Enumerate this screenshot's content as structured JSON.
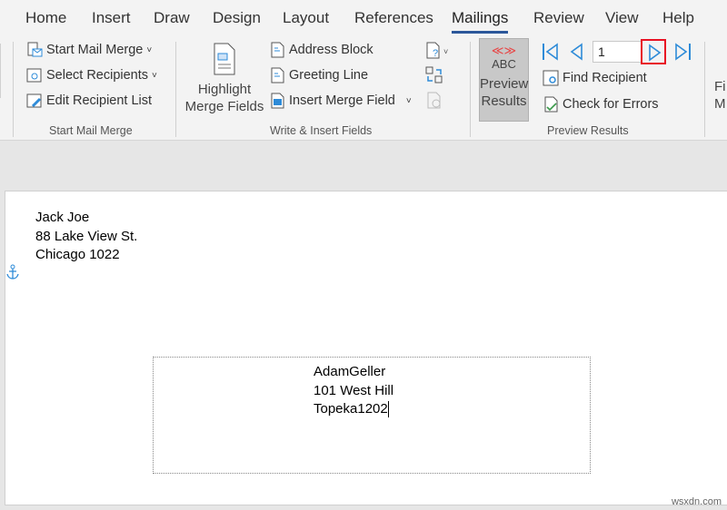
{
  "tabs": [
    "Home",
    "Insert",
    "Draw",
    "Design",
    "Layout",
    "References",
    "Mailings",
    "Review",
    "View",
    "Help"
  ],
  "active_tab": "Mailings",
  "start_mail_merge": {
    "start": "Start Mail Merge",
    "select": "Select Recipients",
    "edit": "Edit Recipient List",
    "group": "Start Mail Merge"
  },
  "write_insert": {
    "highlight1": "Highlight",
    "highlight2": "Merge Fields",
    "address": "Address Block",
    "greeting": "Greeting Line",
    "insert": "Insert Merge Field",
    "group": "Write & Insert Fields"
  },
  "preview": {
    "abc": "ABC",
    "arrows": "≪≫",
    "label1": "Preview",
    "label2": "Results",
    "record": "1",
    "find": "Find Recipient",
    "check": "Check for Errors",
    "group": "Preview Results"
  },
  "finish": {
    "line1": "Fi",
    "line2": "M"
  },
  "document": {
    "return_address": [
      "Jack Joe",
      "88 Lake View St.",
      "Chicago 1022"
    ],
    "recipient_address": [
      "AdamGeller",
      "101 West Hill",
      "Topeka1202"
    ]
  },
  "watermark": "wsxdn.com",
  "colors": {
    "accent": "#2b579a",
    "highlight": "#e81123",
    "nav": "#2e8bd8"
  }
}
